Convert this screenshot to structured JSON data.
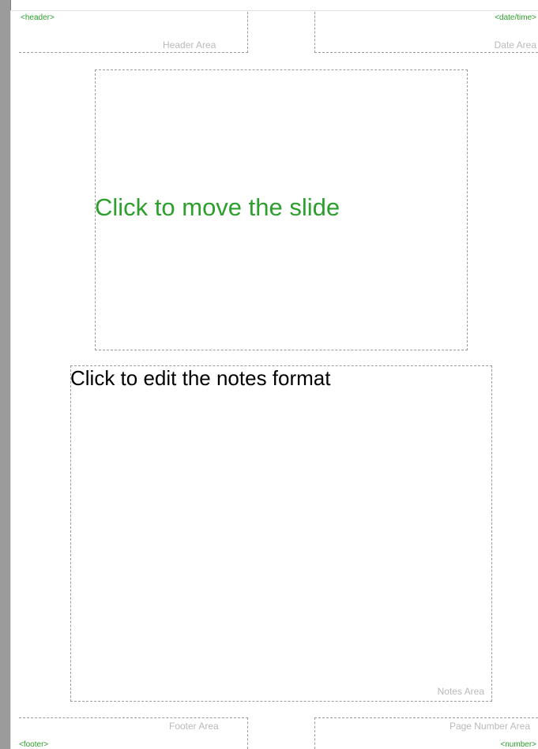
{
  "header": {
    "field": "<header>",
    "label": "Header Area"
  },
  "date": {
    "field": "<date/time>",
    "label": "Date Area"
  },
  "slide": {
    "placeholder": "Click to move the slide"
  },
  "notes": {
    "placeholder": "Click to edit the notes format",
    "label": "Notes Area"
  },
  "footer": {
    "field": "<footer>",
    "label": "Footer Area"
  },
  "page_number": {
    "field": "<number>",
    "label": "Page Number Area"
  },
  "colors": {
    "field_text": "#2c9f2c",
    "area_label": "#b9b9b9",
    "dashed_border": "#9b9b9b",
    "gutter": "#9b9b9b"
  }
}
